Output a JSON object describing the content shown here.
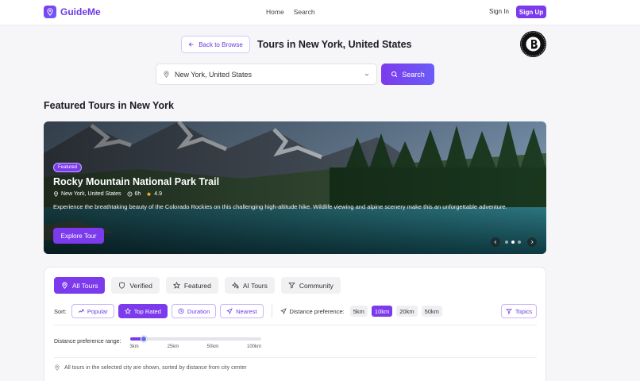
{
  "header": {
    "brand": "GuideMe",
    "nav": [
      "Home",
      "Search"
    ],
    "sign_in": "Sign In",
    "sign_up": "Sign Up"
  },
  "title_row": {
    "back_label": "Back to Browse",
    "title": "Tours in New York, United States"
  },
  "search": {
    "location_value": "New York, United States",
    "button_label": "Search"
  },
  "featured": {
    "section_title": "Featured Tours in New York",
    "chip": "Featured",
    "tour_title": "Rocky Mountain National Park Trail",
    "location": "New York, United States",
    "duration": "6h",
    "rating": "4.9",
    "description": "Experience the breathtaking beauty of the Colorado Rockies on this challenging high-altitude hike. Wildlife viewing and alpine scenery make this an unforgettable adventure.",
    "cta": "Explore Tour",
    "slides": 3,
    "active_slide": 2
  },
  "filters": {
    "tabs": [
      {
        "label": "All Tours",
        "icon": "pin-icon",
        "active": true
      },
      {
        "label": "Verified",
        "icon": "shield-icon",
        "active": false
      },
      {
        "label": "Featured",
        "icon": "star-icon",
        "active": false
      },
      {
        "label": "AI Tours",
        "icon": "sparkle-icon",
        "active": false
      },
      {
        "label": "Community",
        "icon": "filter-icon",
        "active": false
      }
    ],
    "sort_label": "Sort:",
    "sort_options": [
      {
        "label": "Popular",
        "icon": "trending-icon",
        "active": false
      },
      {
        "label": "Top Rated",
        "icon": "star-icon",
        "active": true
      },
      {
        "label": "Duration",
        "icon": "clock-icon",
        "active": false
      },
      {
        "label": "Nearest",
        "icon": "navigate-icon",
        "active": false
      }
    ],
    "distance_label": "Distance preference:",
    "distance_options": [
      {
        "label": "5km",
        "active": false
      },
      {
        "label": "10km",
        "active": true
      },
      {
        "label": "20km",
        "active": false
      },
      {
        "label": "50km",
        "active": false
      }
    ],
    "topics_label": "Topics",
    "range_label": "Distance preference range:",
    "range_ticks": [
      "3km",
      "25km",
      "50km",
      "100km"
    ],
    "range_value_fraction": 0.1,
    "note": "All tours in the selected city are shown, sorted by distance from city center"
  },
  "colors": {
    "accent": "#7c3aed",
    "accent_light": "#c9b6fb"
  }
}
